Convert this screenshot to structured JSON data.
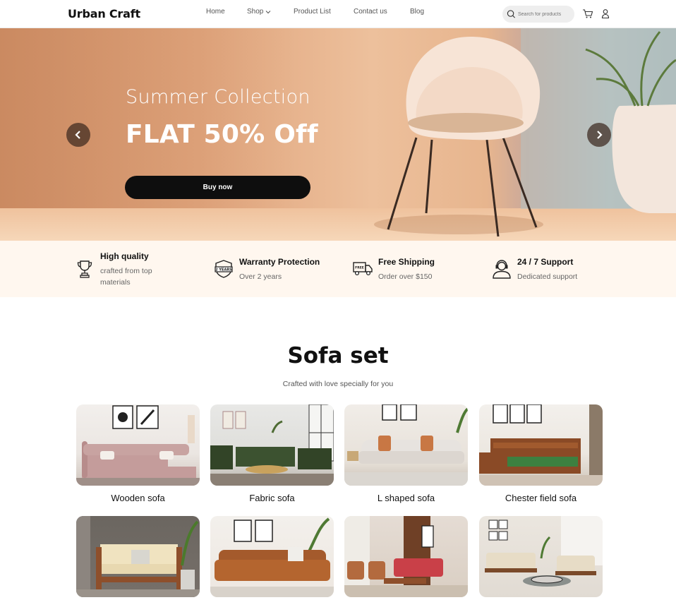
{
  "header": {
    "logo": "Urban Craft",
    "nav": [
      {
        "label": "Home"
      },
      {
        "label": "Shop"
      },
      {
        "label": "Product List"
      },
      {
        "label": "Contact us"
      },
      {
        "label": "Blog"
      }
    ],
    "search": {
      "placeholder": "Search for products",
      "icon": "search-icon"
    },
    "icons": [
      "cart-icon",
      "user-icon"
    ]
  },
  "hero": {
    "subtitle": "Summer Collection",
    "title": "FLAT 50% Off",
    "button": "Buy now",
    "prev_icon": "chevron-left-icon",
    "next_icon": "chevron-right-icon"
  },
  "features": [
    {
      "icon": "trophy-icon",
      "title": "High quality",
      "subtitle": "crafted from top materials"
    },
    {
      "icon": "warranty-badge-icon",
      "title": "Warranty Protection",
      "subtitle": "Over 2 years"
    },
    {
      "icon": "delivery-truck-icon",
      "title": "Free Shipping",
      "subtitle": "Order over $150"
    },
    {
      "icon": "support-agent-icon",
      "title": "24 / 7 Support",
      "subtitle": "Dedicated support"
    }
  ],
  "section": {
    "title": "Sofa set",
    "subtitle": "Crafted with love specially for you",
    "products": [
      {
        "label": "Wooden sofa"
      },
      {
        "label": "Fabric sofa"
      },
      {
        "label": "L shaped sofa"
      },
      {
        "label": "Chester field sofa"
      },
      {
        "label": ""
      },
      {
        "label": ""
      },
      {
        "label": ""
      },
      {
        "label": ""
      }
    ]
  },
  "colors": {
    "accent": "#0e0e0e",
    "features_bg": "#fff7ef",
    "hero_bg": "#e0a57d"
  }
}
